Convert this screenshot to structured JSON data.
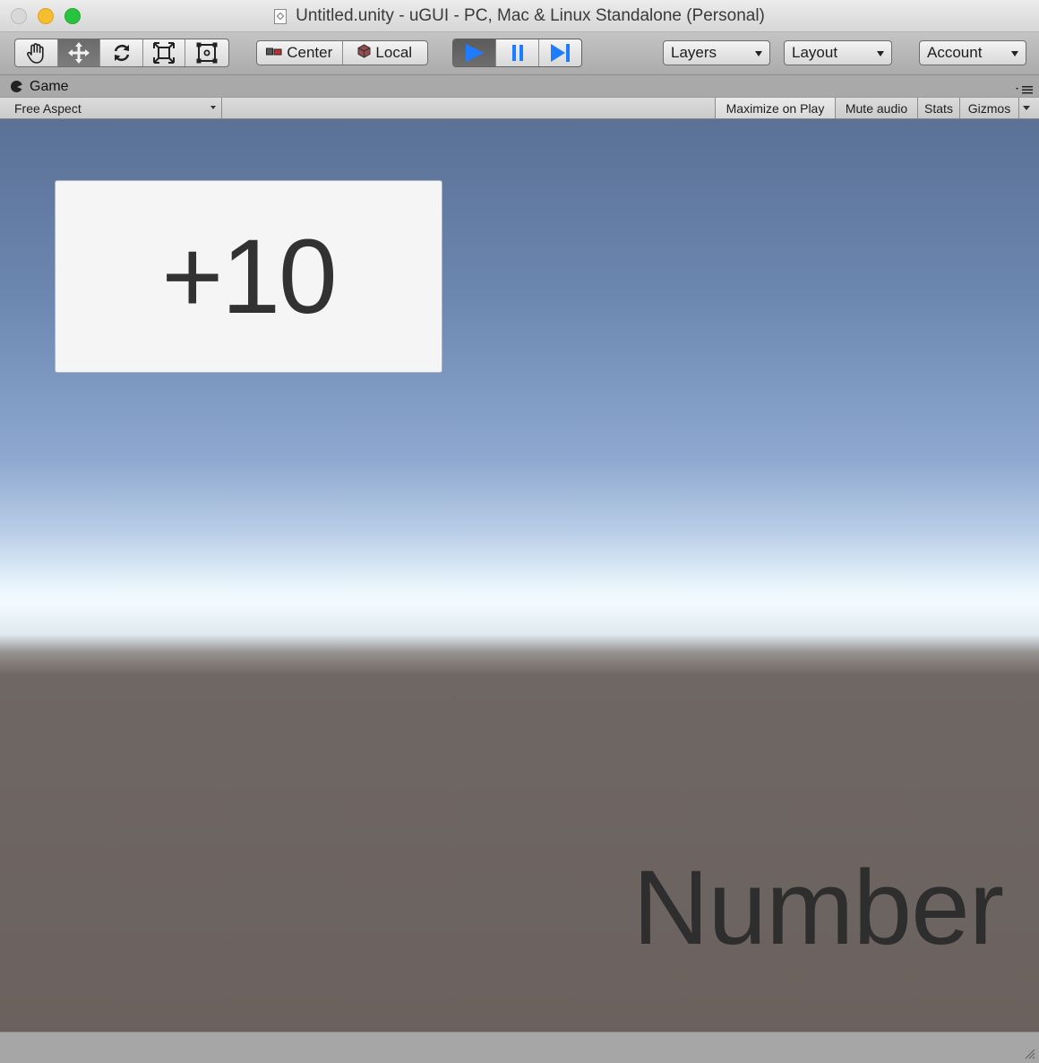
{
  "window": {
    "title": "Untitled.unity - uGUI - PC, Mac & Linux Standalone (Personal)"
  },
  "toolbar": {
    "transform_tools": [
      "hand-tool",
      "move-tool",
      "rotate-tool",
      "scale-tool",
      "rect-tool"
    ],
    "active_tool": "move-tool",
    "pivot_mode": "Center",
    "pivot_rotation": "Local",
    "play_controls": [
      "play",
      "pause",
      "step"
    ],
    "playing": true,
    "layers_label": "Layers",
    "layout_label": "Layout",
    "account_label": "Account"
  },
  "game_view": {
    "tab_label": "Game",
    "aspect": "Free Aspect",
    "maximize_on_play": "Maximize on Play",
    "mute_audio": "Mute audio",
    "stats": "Stats",
    "gizmos": "Gizmos"
  },
  "scene": {
    "score_text": "+10",
    "number_text": "Number"
  },
  "colors": {
    "sky_top": "#5b7196",
    "horizon": "#f3fbff",
    "ground": "#6b625e",
    "play_blue": "#1f7bff"
  }
}
